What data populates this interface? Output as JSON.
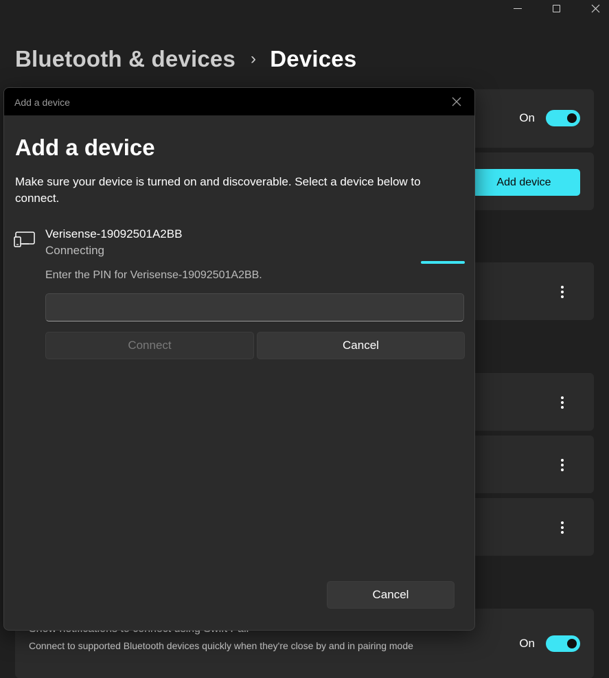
{
  "breadcrumb": {
    "parent": "Bluetooth & devices",
    "separator": "›",
    "current": "Devices"
  },
  "bluetooth_card": {
    "toggle_label": "On",
    "toggle_state": "on"
  },
  "add_device_card": {
    "button_label": "Add device"
  },
  "swift_pair": {
    "title": "Show notifications to connect using Swift Pair",
    "description": "Connect to supported Bluetooth devices quickly when they're close by and in pairing mode",
    "toggle_label": "On",
    "toggle_state": "on"
  },
  "dialog": {
    "caption": "Add a device",
    "heading": "Add a device",
    "description": "Make sure your device is turned on and discoverable. Select a device below to connect.",
    "device": {
      "name": "Verisense-19092501A2BB",
      "status": "Connecting",
      "icon": "device-pair-icon"
    },
    "pin_prompt": "Enter the PIN for Verisense-19092501A2BB.",
    "pin_value": "",
    "pin_placeholder": "",
    "connect_label": "Connect",
    "cancel_label": "Cancel",
    "footer_cancel_label": "Cancel"
  },
  "colors": {
    "accent": "#3de4f4",
    "background": "#202020",
    "card": "#2b2b2b"
  }
}
